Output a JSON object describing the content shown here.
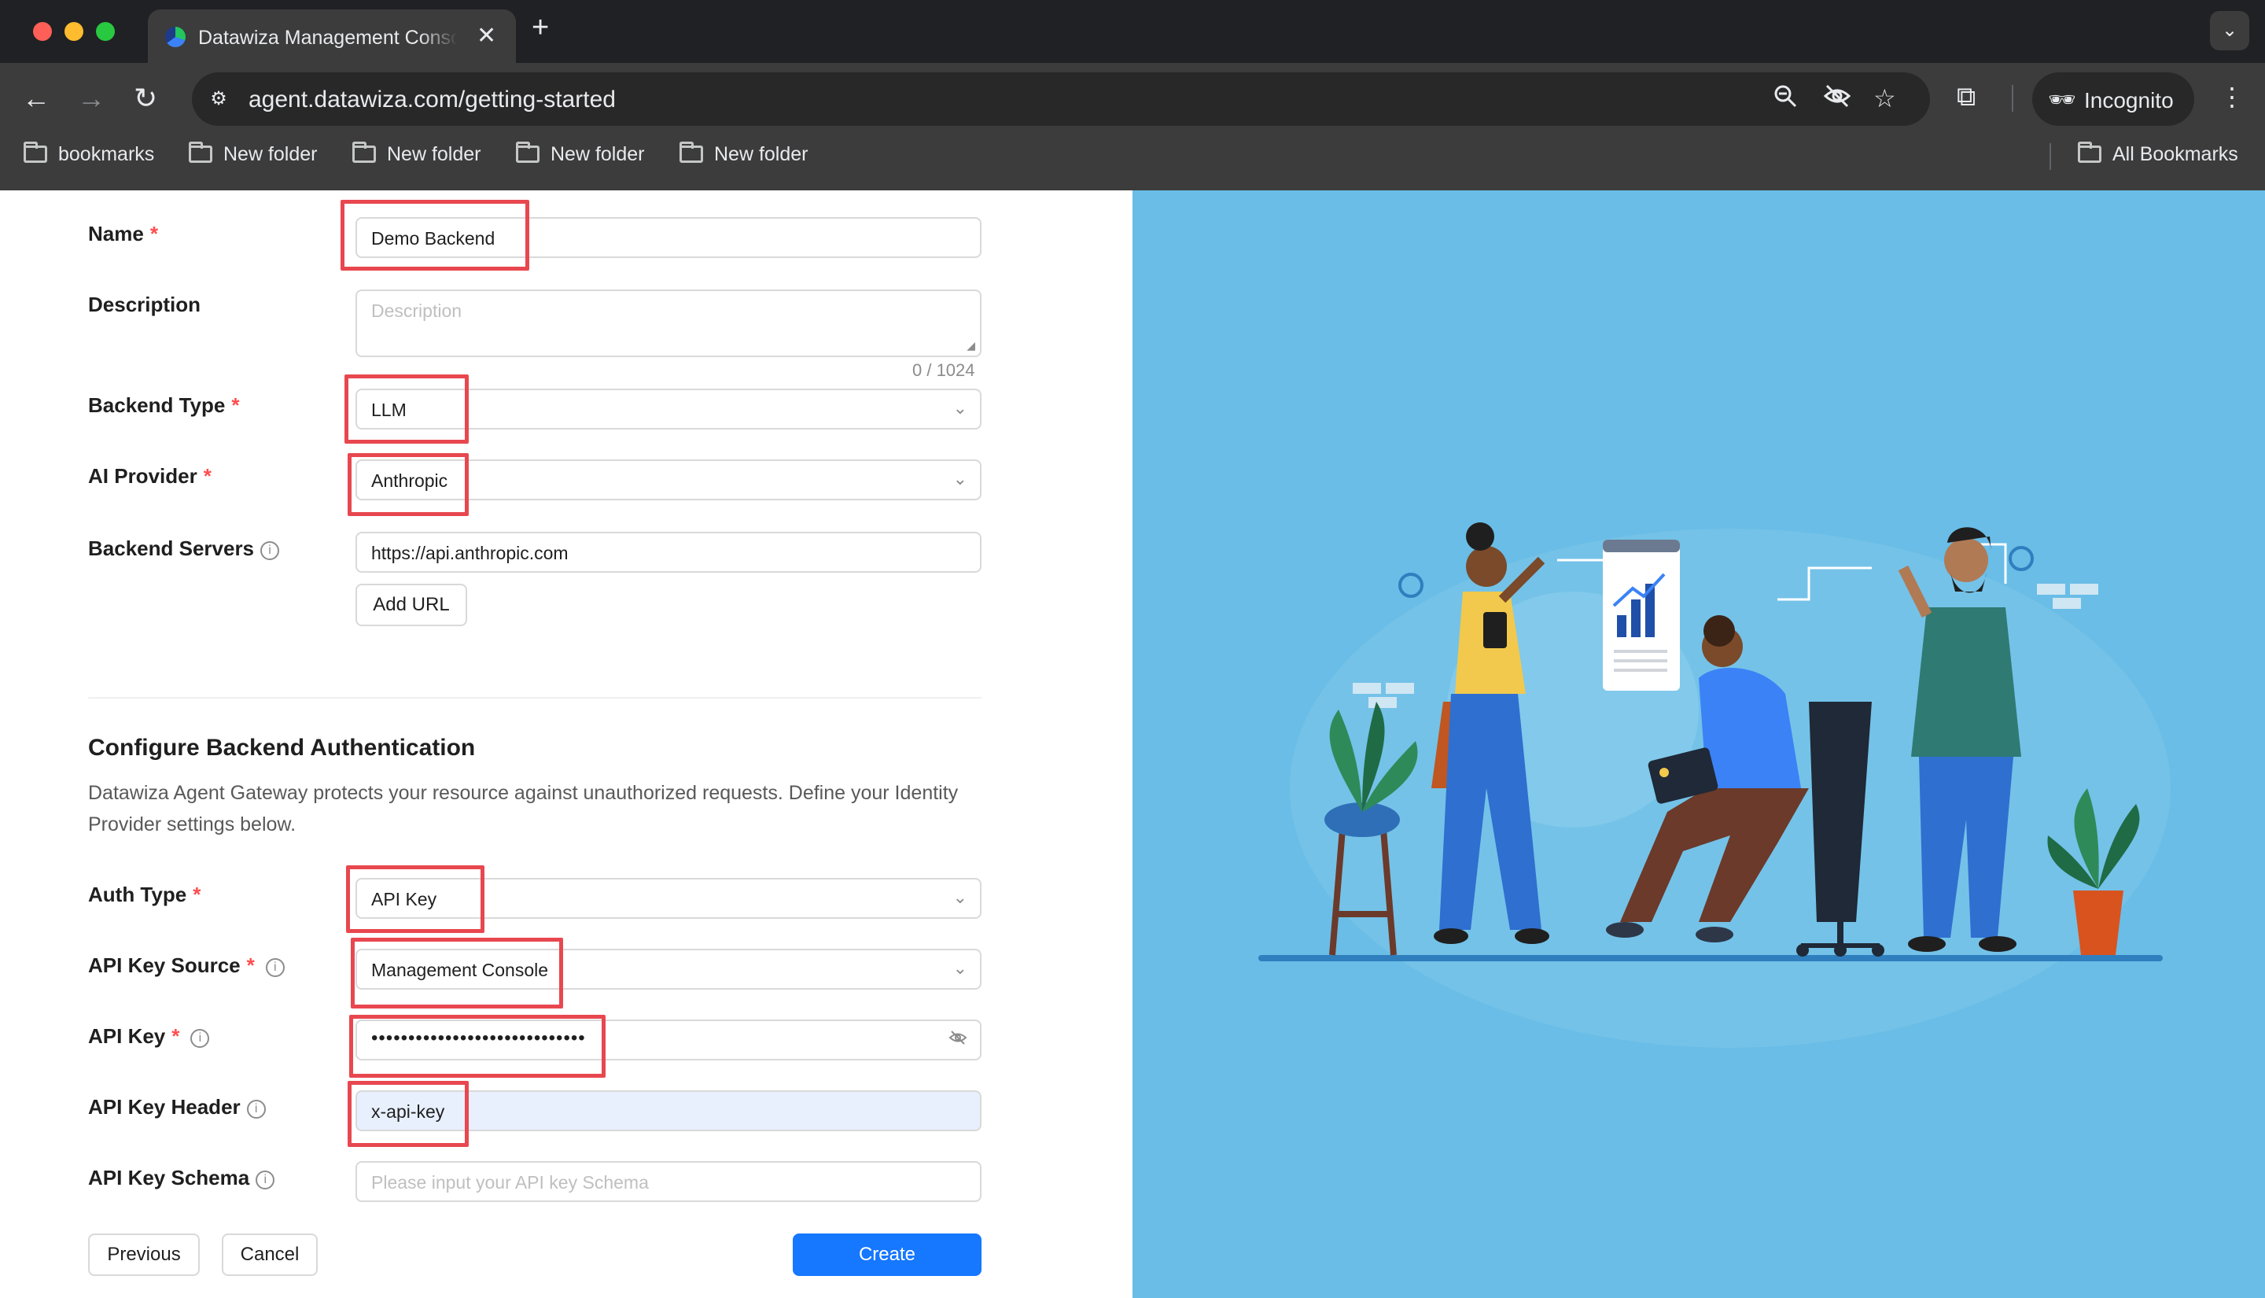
{
  "browser": {
    "tab_title": "Datawiza Management Console",
    "url": "agent.datawiza.com/getting-started",
    "incognito_label": "Incognito",
    "bookmarks": [
      "bookmarks",
      "New folder",
      "New folder",
      "New folder",
      "New folder"
    ],
    "all_bookmarks_label": "All Bookmarks"
  },
  "form": {
    "name": {
      "label": "Name",
      "value": "Demo Backend"
    },
    "description": {
      "label": "Description",
      "placeholder": "Description",
      "counter": "0 / 1024"
    },
    "backend_type": {
      "label": "Backend Type",
      "value": "LLM"
    },
    "ai_provider": {
      "label": "AI Provider",
      "value": "Anthropic"
    },
    "backend_servers": {
      "label": "Backend Servers",
      "value": "https://api.anthropic.com",
      "add_url_label": "Add URL"
    },
    "auth_section": {
      "title": "Configure Backend Authentication",
      "description": "Datawiza Agent Gateway protects your resource against unauthorized requests. Define your Identity Provider settings below."
    },
    "auth_type": {
      "label": "Auth Type",
      "value": "API Key"
    },
    "api_key_source": {
      "label": "API Key Source",
      "value": "Management Console"
    },
    "api_key": {
      "label": "API Key",
      "masked_value": "•••••••••••••••••••••••••••••"
    },
    "api_key_header": {
      "label": "API Key Header",
      "value": "x-api-key"
    },
    "api_key_schema": {
      "label": "API Key Schema",
      "placeholder": "Please input your API key Schema"
    },
    "buttons": {
      "previous": "Previous",
      "cancel": "Cancel",
      "create": "Create"
    }
  },
  "colors": {
    "primary": "#1677ff",
    "required": "#ff4d4f",
    "highlight": "#e8474f",
    "illustration_bg": "#69bde6"
  }
}
